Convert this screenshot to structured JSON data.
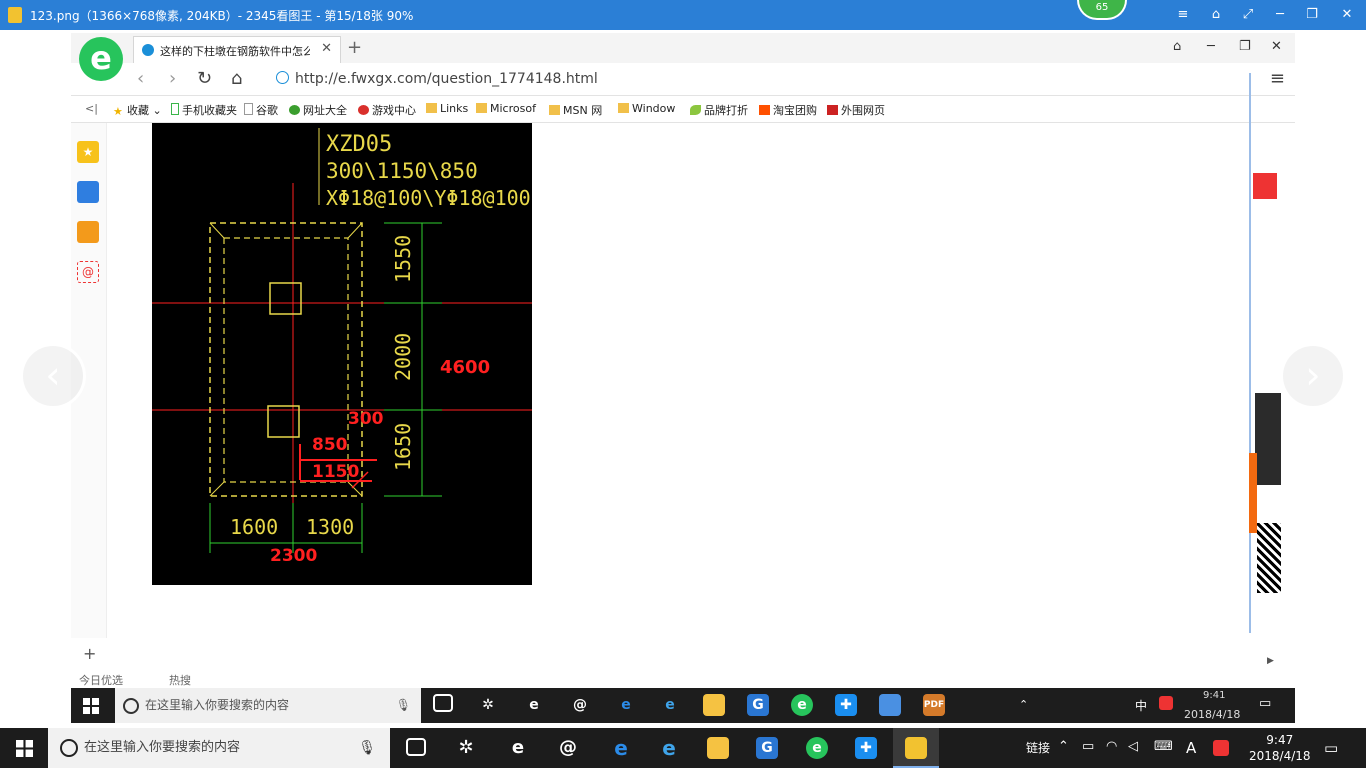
{
  "viewer": {
    "title": "123.png（1366×768像素, 204KB）- 2345看图王 - 第15/18张 90%",
    "badge": "65",
    "controls": [
      "≡",
      "⌂",
      "⤢",
      "─",
      "❐",
      "✕"
    ],
    "prev_arrow": "‹",
    "next_arrow": "›"
  },
  "browser": {
    "logo": "e",
    "tab_label": "这样的下柱墩在钢筋软件中怎么布",
    "tab_close": "✕",
    "new_tab": "+",
    "window_controls": [
      "⌂",
      "─",
      "❐",
      "✕"
    ],
    "url": "http://e.fwxgx.com/question_1774148.html",
    "menu": "≡"
  },
  "bookmarks": [
    {
      "label": "收藏",
      "icon": "star-icon"
    },
    {
      "label": "手机收藏夹",
      "icon": "phone-icon"
    },
    {
      "label": "谷歌",
      "icon": "page-icon"
    },
    {
      "label": "网址大全",
      "icon": "globe-icon"
    },
    {
      "label": "游戏中心",
      "icon": "game-icon"
    },
    {
      "label": "Links",
      "icon": "folder-icon"
    },
    {
      "label": "Microsof",
      "icon": "folder-icon"
    },
    {
      "label": "MSN 网",
      "icon": "folder-icon"
    },
    {
      "label": "Window",
      "icon": "folder-icon"
    },
    {
      "label": "品牌打折",
      "icon": "leaf-icon"
    },
    {
      "label": "淘宝团购",
      "icon": "taobao-icon"
    },
    {
      "label": "外围网页",
      "icon": "bookmark-icon"
    }
  ],
  "cad": {
    "name": "XZD05",
    "dims": "300\\1150\\850",
    "rebar": "XΦ18@100\\YΦ18@100",
    "v1": "1550",
    "v2": "2000",
    "v3": "1650",
    "total_v": "4600",
    "d300": "300",
    "d850": "850",
    "d1150": "1150",
    "h1": "1600",
    "h2": "1300",
    "total_h": "2300"
  },
  "inner_status": {
    "add": "+",
    "today": "今日优选",
    "hot": "热搜"
  },
  "inner_taskbar": {
    "search_placeholder": "在这里输入你要搜索的内容",
    "time": "9:41",
    "date": "2018/4/18",
    "ime": "中"
  },
  "taskbar": {
    "search_placeholder": "在这里输入你要搜索的内容",
    "links_label": "链接",
    "ime": "A",
    "time": "9:47",
    "date": "2018/4/18"
  },
  "colors": {
    "viewer_titlebar": "#2b7fd6",
    "cad_background": "#000000",
    "cad_yellow": "#e8d84a",
    "cad_red": "#ff2020",
    "cad_green": "#2fd02f"
  }
}
